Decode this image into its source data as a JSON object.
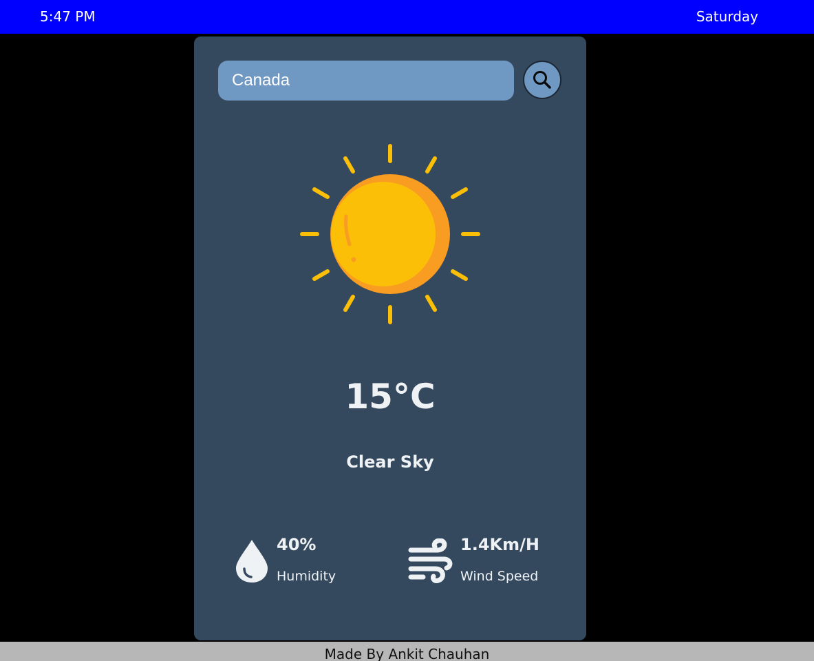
{
  "status_bar": {
    "time": "5:47 PM",
    "day": "Saturday"
  },
  "search": {
    "value": "Canada",
    "button_icon": "search-icon"
  },
  "weather": {
    "icon": "sun-icon",
    "temperature": "15°C",
    "condition": "Clear Sky"
  },
  "stats": {
    "humidity": {
      "icon": "water-drop-icon",
      "value": "40%",
      "label": "Humidity"
    },
    "wind": {
      "icon": "wind-icon",
      "value": "1.4Km/H",
      "label": "Wind Speed"
    }
  },
  "footer": {
    "credit": "Made By Ankit Chauhan"
  },
  "colors": {
    "top_bar": "#0000ff",
    "card": "#35495e",
    "input": "#6f98c2",
    "sun": "#fbbf07",
    "sun_shade": "#f99c22",
    "footer": "#b7b7b7"
  }
}
